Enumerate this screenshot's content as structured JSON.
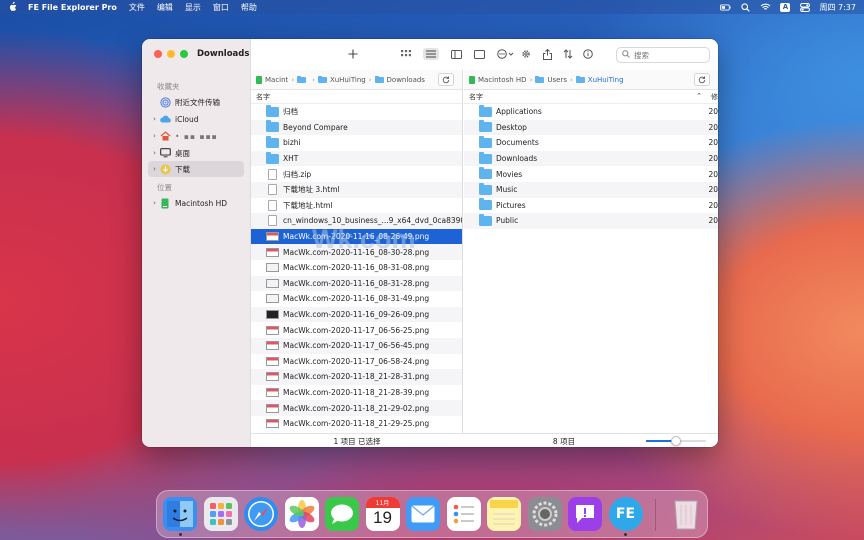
{
  "menubar": {
    "app_name": "FE File Explorer Pro",
    "menus": [
      "文件",
      "编辑",
      "显示",
      "窗口",
      "帮助"
    ],
    "input_badge": "A",
    "clock": "周四 7:37"
  },
  "window": {
    "title": "Downloads",
    "search_placeholder": "搜索"
  },
  "sidebar": {
    "favorites_label": "收藏夹",
    "locations_label": "位置",
    "items": [
      {
        "label": "附近文件传输"
      },
      {
        "label": "iCloud"
      },
      {
        "label": "• ▪▪ ▪▪▪"
      },
      {
        "label": "桌面"
      },
      {
        "label": "下载"
      }
    ],
    "locations": [
      {
        "label": "Macintosh HD"
      }
    ]
  },
  "left_pane": {
    "path": [
      "Macint",
      "",
      "XuHuiTing",
      "Downloads"
    ],
    "column_header": "名字",
    "files": [
      {
        "name": "归档",
        "kind": "folder"
      },
      {
        "name": "Beyond Compare",
        "kind": "folder"
      },
      {
        "name": "bizhi",
        "kind": "folder"
      },
      {
        "name": "XHT",
        "kind": "folder"
      },
      {
        "name": "归档.zip",
        "kind": "doc"
      },
      {
        "name": "下载地址 3.html",
        "kind": "doc"
      },
      {
        "name": "下载地址.html",
        "kind": "doc"
      },
      {
        "name": "cn_windows_10_business_...9_x64_dvd_0ca83907.iso",
        "kind": "doc"
      },
      {
        "name": "MacWk.com-2020-11-16_08-26-49.png",
        "kind": "png"
      },
      {
        "name": "MacWk.com-2020-11-16_08-30-28.png",
        "kind": "png"
      },
      {
        "name": "MacWk.com-2020-11-16_08-31-08.png",
        "kind": "png-plain"
      },
      {
        "name": "MacWk.com-2020-11-16_08-31-28.png",
        "kind": "png-plain"
      },
      {
        "name": "MacWk.com-2020-11-16_08-31-49.png",
        "kind": "png-plain"
      },
      {
        "name": "MacWk.com-2020-11-16_09-26-09.png",
        "kind": "png-dark"
      },
      {
        "name": "MacWk.com-2020-11-17_06-56-25.png",
        "kind": "png"
      },
      {
        "name": "MacWk.com-2020-11-17_06-56-45.png",
        "kind": "png"
      },
      {
        "name": "MacWk.com-2020-11-17_06-58-24.png",
        "kind": "png"
      },
      {
        "name": "MacWk.com-2020-11-18_21-28-31.png",
        "kind": "png"
      },
      {
        "name": "MacWk.com-2020-11-18_21-28-39.png",
        "kind": "png"
      },
      {
        "name": "MacWk.com-2020-11-18_21-29-02.png",
        "kind": "png"
      },
      {
        "name": "MacWk.com-2020-11-18_21-29-25.png",
        "kind": "png"
      }
    ],
    "selected_index": 8,
    "status": "1 项目 已选择"
  },
  "right_pane": {
    "path": [
      "Macintosh HD",
      "Users",
      "XuHuiTing"
    ],
    "column_header": "名字",
    "column_header_extra": "修",
    "folders": [
      {
        "name": "Applications",
        "date": "20"
      },
      {
        "name": "Desktop",
        "date": "20"
      },
      {
        "name": "Documents",
        "date": "20"
      },
      {
        "name": "Downloads",
        "date": "20"
      },
      {
        "name": "Movies",
        "date": "20"
      },
      {
        "name": "Music",
        "date": "20"
      },
      {
        "name": "Pictures",
        "date": "20"
      },
      {
        "name": "Public",
        "date": "20"
      }
    ],
    "status": "8 项目",
    "zoom_level": 0.5
  },
  "watermark": "Wk.com",
  "dock": {
    "apps": [
      {
        "name": "finder-icon",
        "color": "#3a8ef0",
        "running": true
      },
      {
        "name": "launchpad-icon",
        "color": "#e9e9ee",
        "running": false
      },
      {
        "name": "safari-icon",
        "color": "#2f8cf0",
        "running": false
      },
      {
        "name": "photos-icon",
        "color": "#ffffff",
        "running": false
      },
      {
        "name": "messages-icon",
        "color": "#39c84a",
        "running": false
      },
      {
        "name": "calendar-icon",
        "color": "#ffffff",
        "running": false
      },
      {
        "name": "mail-icon",
        "color": "#3f9bf5",
        "running": false
      },
      {
        "name": "reminders-icon",
        "color": "#ffffff",
        "running": false
      },
      {
        "name": "notes-icon",
        "color": "#fff3b0",
        "running": false
      },
      {
        "name": "system-preferences-icon",
        "color": "#8c8c92",
        "running": false
      },
      {
        "name": "feedback-assistant-icon",
        "color": "#9b3fe8",
        "running": false
      },
      {
        "name": "fe-file-explorer-icon",
        "color": "#2fa8ea",
        "running": true
      }
    ],
    "calendar_month": "11月",
    "calendar_day": "19",
    "fe_label": "FE"
  }
}
